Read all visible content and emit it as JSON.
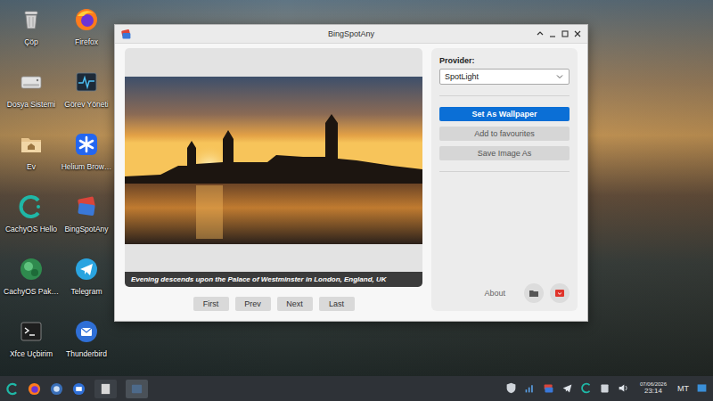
{
  "desktop": {
    "icons": [
      {
        "label": "Çöp"
      },
      {
        "label": "Firefox"
      },
      {
        "label": "Dosya Sistemi"
      },
      {
        "label": "Görev Yöneti"
      },
      {
        "label": "Ev"
      },
      {
        "label": "Helium Brow…"
      },
      {
        "label": "CachyOS Hello"
      },
      {
        "label": "BingSpotAny"
      },
      {
        "label": "CachyOS Pak…"
      },
      {
        "label": "Telegram"
      },
      {
        "label": "Xfce Uçbirim"
      },
      {
        "label": "Thunderbird"
      }
    ]
  },
  "window": {
    "title": "BingSpotAny"
  },
  "preview": {
    "caption": "Evening descends upon the Palace of Westminster in London, England, UK"
  },
  "navigation": {
    "buttons": [
      "First",
      "Prev",
      "Next",
      "Last"
    ]
  },
  "sidebar": {
    "provider_label": "Provider:",
    "provider": "SpotLight",
    "actions": [
      {
        "label": "Set As Wallpaper",
        "kind": "primary"
      },
      {
        "label": "Add to favourites",
        "kind": "secondary"
      },
      {
        "label": "Save Image As",
        "kind": "secondary"
      }
    ],
    "about": "About"
  },
  "taskbar": {
    "date": "07/06/2026",
    "time": "23:14",
    "layout": "MT"
  }
}
